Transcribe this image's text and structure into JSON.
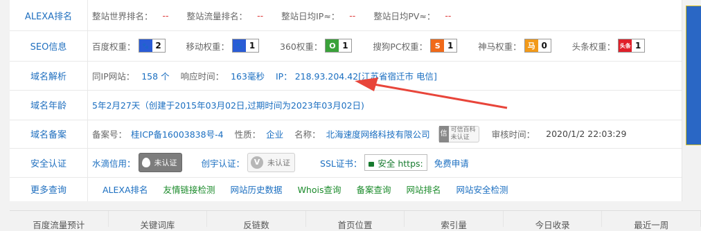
{
  "rows": {
    "alexa": {
      "label": "ALEXA排名",
      "world_rank_key": "整站世界排名：",
      "world_rank_val": "--",
      "traffic_rank_key": "整站流量排名：",
      "traffic_rank_val": "--",
      "daily_ip_key": "整站日均IP≈：",
      "daily_ip_val": "--",
      "daily_pv_key": "整站日均PV≈：",
      "daily_pv_val": "--"
    },
    "seo": {
      "label": "SEO信息",
      "items": [
        {
          "key": "百度权重：",
          "icon": "paw-icon",
          "icon_text": "🐾",
          "value": "2",
          "color": "#2a5cd6"
        },
        {
          "key": "移动权重：",
          "icon": "paw-icon",
          "icon_text": "🐾",
          "value": "1",
          "color": "#2a5cd6"
        },
        {
          "key": "360权重：",
          "icon": "360-icon",
          "icon_text": "O",
          "value": "1",
          "color": "#3aa23a"
        },
        {
          "key": "搜狗PC权重：",
          "icon": "sogou-icon",
          "icon_text": "S",
          "value": "1",
          "color": "#f06a1a"
        },
        {
          "key": "神马权重：",
          "icon": "shenma-icon",
          "icon_text": "马",
          "value": "0",
          "color": "#f29a1a"
        },
        {
          "key": "头条权重：",
          "icon": "toutiao-icon",
          "icon_text": "头条",
          "value": "1",
          "color": "#e0202a"
        }
      ]
    },
    "domain": {
      "label": "域名解析",
      "same_ip_key": "同IP网站：",
      "same_ip_val": "158 个",
      "resp_key": "响应时间：",
      "resp_val": "163毫秒",
      "ip_key": "IP：",
      "ip_val": "218.93.204.42[江苏省宿迁市 电信]"
    },
    "age": {
      "label": "域名年龄",
      "value": "5年2月27天（创建于2015年03月02日,过期时间为2023年03月02日)"
    },
    "icp": {
      "label": "域名备案",
      "no_key": "备案号：",
      "no_val": "桂ICP备16003838号-4",
      "nature_key": "性质：",
      "nature_val": "企业",
      "name_key": "名称：",
      "name_val": "北海速度网络科技有限公司",
      "baike_line1": "可信百科",
      "baike_line2": "未认证",
      "audit_key": "审核时间：",
      "audit_val": "2020/1/2 22:03:29"
    },
    "security": {
      "label": "安全认证",
      "shuidi_key": "水滴信用：",
      "shuidi_badge": "未认证",
      "chuangyu_key": "创宇认证：",
      "chuangyu_badge": "未认证",
      "ssl_key": "SSL证书：",
      "ssl_badge": "安全 https:",
      "ssl_link": "免费申请"
    },
    "more": {
      "label": "更多查询",
      "links": [
        "ALEXA排名",
        "友情链接检测",
        "网站历史数据",
        "Whois查询",
        "备案查询",
        "网站排名",
        "网站安全检测"
      ]
    }
  },
  "footer": [
    "百度流量预计",
    "关键词库",
    "反链数",
    "首页位置",
    "索引量",
    "今日收录",
    "最近一周"
  ]
}
